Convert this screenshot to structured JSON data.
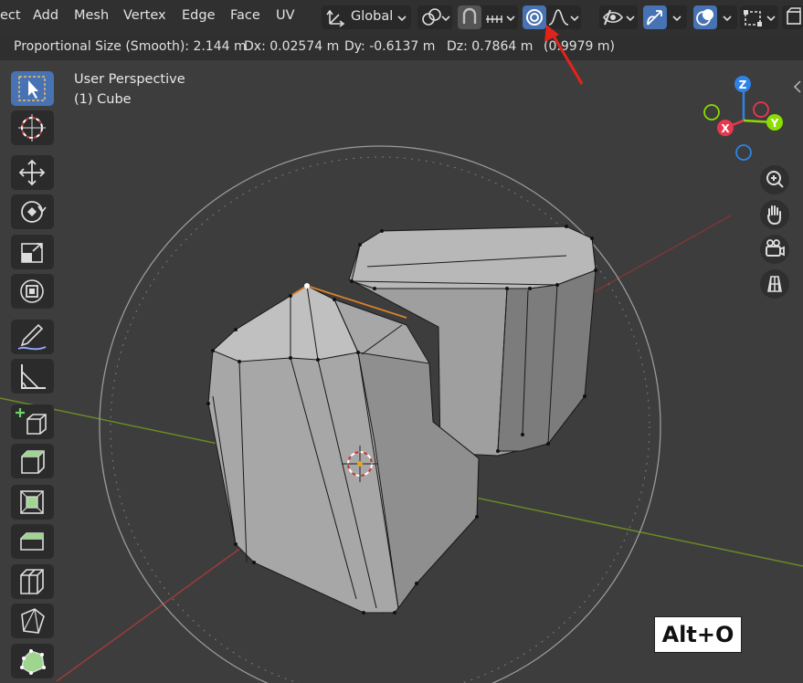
{
  "header": {
    "menus": [
      "ect",
      "Add",
      "Mesh",
      "Vertex",
      "Edge",
      "Face",
      "UV"
    ],
    "transform_orientation": "Global",
    "icons": [
      "transform-orientation-icon",
      "pivot-point-icon",
      "snap-icon",
      "snap-increment-icon",
      "proportional-editing-icon",
      "proportional-falloff-icon",
      "visibility-icon",
      "gizmo-icon",
      "overlay-icon",
      "xray-icon"
    ]
  },
  "status": {
    "proportional": "Proportional Size (Smooth): 2.144 m",
    "dx": "Dx: 0.02574 m",
    "dy": "Dy: -0.6137 m",
    "dz": "Dz: 0.7864 m",
    "dz_paren": "(0.9979 m)"
  },
  "viewport": {
    "view_name": "User Perspective",
    "object_name": "(1) Cube"
  },
  "gizmo": {
    "x": "X",
    "y": "Y",
    "z": "Z"
  },
  "toolbar": [
    "select-box",
    "cursor",
    "move",
    "rotate",
    "scale",
    "transform",
    "annotate",
    "measure",
    "add-cube",
    "extrude",
    "inset",
    "bevel",
    "loop-cut",
    "knife",
    "poly-build"
  ],
  "annotation": {
    "shortcut": "Alt+O",
    "arrow_color": "#e0241c"
  },
  "colors": {
    "accent": "#4772b3",
    "x_axis": "#e8384f",
    "y_axis": "#8bdc00",
    "z_axis": "#2f83e6"
  }
}
